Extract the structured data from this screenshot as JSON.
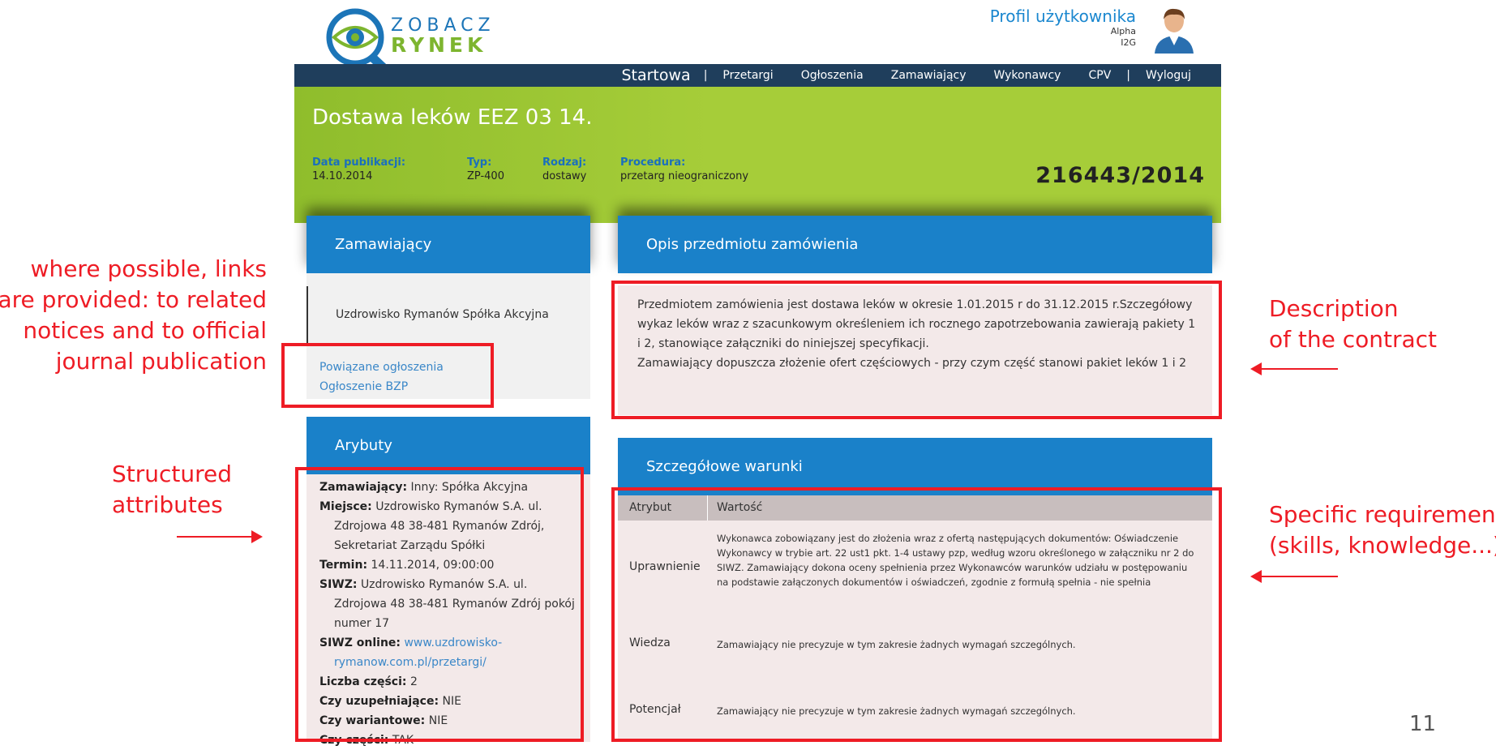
{
  "header": {
    "logo_line1": "ZOBACZ",
    "logo_line2": "RYNEK",
    "profile_title": "Profil użytkownika",
    "profile_line1": "Alpha",
    "profile_line2": "I2G"
  },
  "nav": {
    "home": "Startowa",
    "sep": "|",
    "items": [
      "Przetargi",
      "Ogłoszenia",
      "Zamawiający",
      "Wykonawcy",
      "CPV"
    ],
    "logout": "Wyloguj"
  },
  "notice": {
    "title": "Dostawa leków EEZ 03 14.",
    "number": "216443/2014",
    "meta": [
      {
        "label": "Data publikacji:",
        "value": "14.10.2014"
      },
      {
        "label": "Typ:",
        "value": "ZP-400"
      },
      {
        "label": "Rodzaj:",
        "value": "dostawy"
      },
      {
        "label": "Procedura:",
        "value": "przetarg nieograniczony"
      }
    ]
  },
  "left": {
    "buyer_title": "Zamawiający",
    "buyer_name": "Uzdrowisko Rymanów Spółka Akcyjna",
    "links": [
      "Powiązane ogłoszenia",
      "Ogłoszenie BZP"
    ],
    "attrs_title": "Arybuty",
    "attrs": [
      {
        "k": "Zamawiający:",
        "v": "Inny: Spółka Akcyjna"
      },
      {
        "k": "Miejsce:",
        "v": "Uzdrowisko Rymanów S.A. ul. Zdrojowa 48 38-481 Rymanów Zdrój, Sekretariat Zarządu Spółki"
      },
      {
        "k": "Termin:",
        "v": "14.11.2014, 09:00:00"
      },
      {
        "k": "SIWZ:",
        "v": "Uzdrowisko Rymanów S.A. ul. Zdrojowa 48 38-481 Rymanów Zdrój pokój numer 17"
      },
      {
        "k": "SIWZ online:",
        "v": "www.uzdrowisko-rymanow.com.pl/przetargi/"
      },
      {
        "k": "Liczba części:",
        "v": "2"
      },
      {
        "k": "Czy uzupełniające:",
        "v": "NIE"
      },
      {
        "k": "Czy wariantowe:",
        "v": "NIE"
      },
      {
        "k": "Czy części:",
        "v": "TAK"
      }
    ]
  },
  "right": {
    "desc_title": "Opis przedmiotu zamówienia",
    "desc_text": "Przedmiotem zamówienia jest dostawa leków w okresie 1.01.2015 r do 31.12.2015 r.Szczegółowy wykaz leków wraz z szacunkowym określeniem ich rocznego zapotrzebowania zawierają pakiety 1 i 2, stanowiące załączniki do niniejszej specyfikacji.",
    "desc_text2": "Zamawiający dopuszcza złożenie ofert częściowych - przy czym część stanowi pakiet leków 1 i 2",
    "req_title": "Szczegółowe warunki",
    "col_attr": "Atrybut",
    "col_value": "Wartość",
    "rows": [
      {
        "k": "Uprawnienie",
        "v": "Wykonawca zobowiązany jest do złożenia wraz z ofertą następujących dokumentów: Oświadczenie Wykonawcy w trybie art. 22 ust1 pkt. 1-4 ustawy pzp, według wzoru określonego w załączniku nr 2 do SIWZ. Zamawiający dokona oceny spełnienia przez Wykonawców warunków udziału w postępowaniu na podstawie załączonych dokumentów i oświadczeń, zgodnie z formułą spełnia - nie spełnia"
      },
      {
        "k": "Wiedza",
        "v": "Zamawiający nie precyzuje w tym zakresie żadnych wymagań szczególnych."
      },
      {
        "k": "Potencjał",
        "v": "Zamawiający nie precyzuje w tym zakresie żadnych wymagań szczególnych."
      }
    ]
  },
  "annotations": {
    "links_note": [
      "where possible, links",
      "are provided: to related",
      "notices and to official",
      "journal publication"
    ],
    "attrs_note": [
      "Structured",
      "attributes"
    ],
    "desc_note": [
      "Description",
      "of the contract"
    ],
    "req_note": [
      "Specific requiremens",
      "(skills, knowledge...)"
    ]
  },
  "page_number": "11"
}
